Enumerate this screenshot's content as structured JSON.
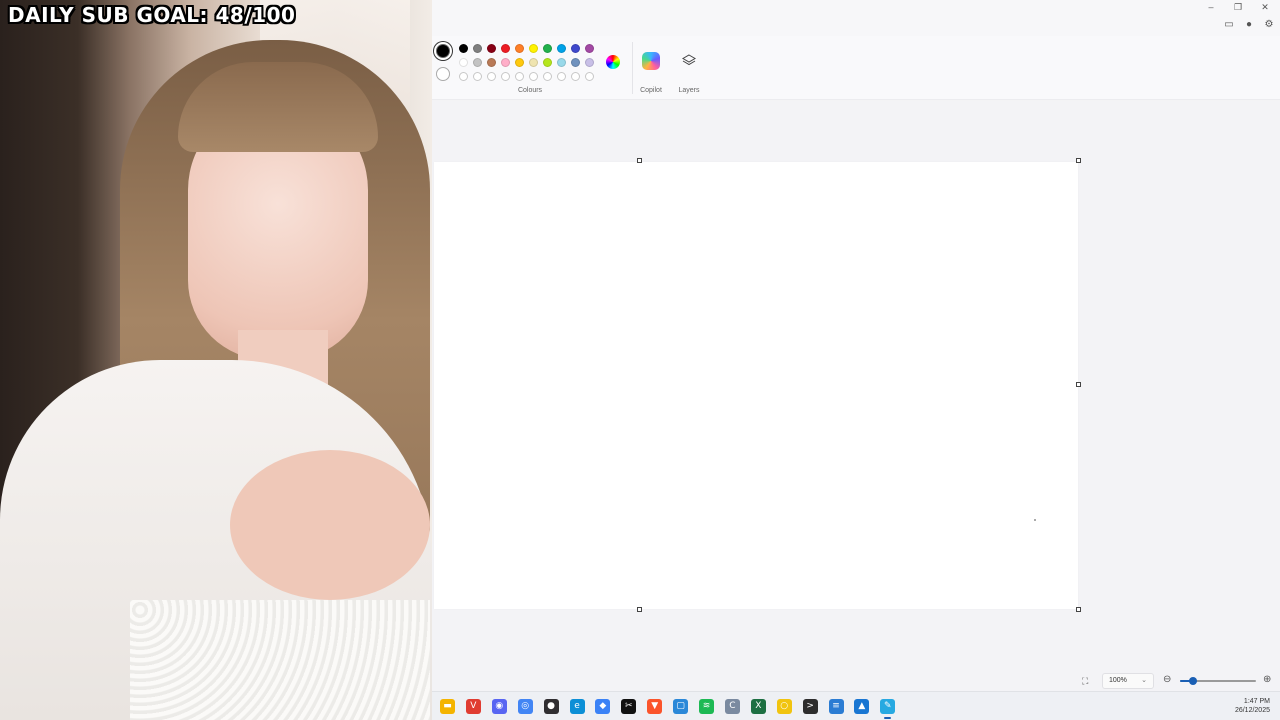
{
  "stream": {
    "sub_goal_text": "DAILY SUB GOAL: 48/100"
  },
  "paint": {
    "ribbon": {
      "colours_label": "Colours",
      "copilot_label": "Copilot",
      "layers_label": "Layers",
      "primary_colour": "#000000",
      "secondary_colour": "#ffffff",
      "palette_row1": [
        "#000000",
        "#7f7f7f",
        "#880015",
        "#ed1c24",
        "#ff7f27",
        "#fff200",
        "#22b14c",
        "#00a2e8",
        "#3f48cc",
        "#a349a4"
      ],
      "palette_row2": [
        "#ffffff",
        "#c3c3c3",
        "#b97a57",
        "#ffaec9",
        "#ffc90e",
        "#efe4b0",
        "#b5e61d",
        "#99d9ea",
        "#7092be",
        "#c8bfe7"
      ],
      "custom_slots_count": 10
    },
    "status": {
      "zoom_value": "100%",
      "zoom_level_fraction": 0.17
    }
  },
  "taskbar": {
    "apps": [
      {
        "name": "file-explorer",
        "icon": "folder-icon",
        "color": "#f4b400"
      },
      {
        "name": "vivaldi",
        "icon": "vivaldi-icon",
        "color": "#e03c31"
      },
      {
        "name": "discord",
        "icon": "discord-icon",
        "color": "#5865f2"
      },
      {
        "name": "chrome",
        "icon": "chrome-icon",
        "color": "#4285f4"
      },
      {
        "name": "obs",
        "icon": "obs-icon",
        "color": "#302e31"
      },
      {
        "name": "edge",
        "icon": "edge-icon",
        "color": "#0c8fd6"
      },
      {
        "name": "app-blue",
        "icon": "diamond-icon",
        "color": "#3b82f6"
      },
      {
        "name": "capcut",
        "icon": "capcut-icon",
        "color": "#111111"
      },
      {
        "name": "brave",
        "icon": "brave-icon",
        "color": "#fb542b"
      },
      {
        "name": "app-square",
        "icon": "square-icon",
        "color": "#2b88d8"
      },
      {
        "name": "spotify",
        "icon": "spotify-icon",
        "color": "#1db954"
      },
      {
        "name": "app-c",
        "icon": "c-icon",
        "color": "#7a8aa0"
      },
      {
        "name": "excel",
        "icon": "excel-icon",
        "color": "#1d6f42"
      },
      {
        "name": "app-yellow",
        "icon": "ring-icon",
        "color": "#f1c40f"
      },
      {
        "name": "terminal",
        "icon": "terminal-icon",
        "color": "#2d2d2d"
      },
      {
        "name": "notepad",
        "icon": "notepad-icon",
        "color": "#2b7cd3"
      },
      {
        "name": "photos",
        "icon": "photos-icon",
        "color": "#1976d2"
      },
      {
        "name": "paint",
        "icon": "paint-icon",
        "color": "#27a9e1"
      }
    ],
    "time": "1:47 PM",
    "date": "26/12/2025"
  }
}
